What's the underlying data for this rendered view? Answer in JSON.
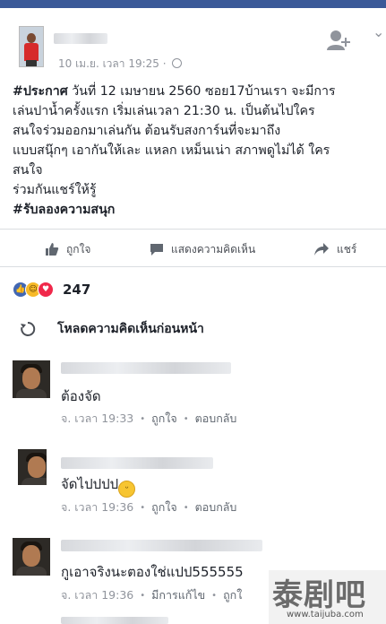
{
  "post": {
    "timestamp": "10 เม.ย. เวลา 19:25 · ",
    "hashtag_line1": "#ประกาศ",
    "body_line1": " วันที่ 12 เมษายน 2560 ซอย17บ้านเรา จะมีการ",
    "body_rest": "เล่นปาน้ำครั้งแรก เริ่มเล่นเวลา 21:30 น. เป็นต้นไปใคร\nสนใจร่วมออกมาเล่นกัน ต้อนรับสงการ์นที่จะมาถึง\nแบบสนุ๊กๆ เอากันให้เละ แหลก เหม็นเน่า สภาพดูไม่ได้ ใคร\nสนใจ\nร่วมกันแชร์ให้รู้",
    "hashtag_end": "#รับลองความสนุก"
  },
  "actions": {
    "like": "ถูกใจ",
    "comment": "แสดงความคิดเห็น",
    "share": "แชร์"
  },
  "reactions": {
    "count": "247"
  },
  "load_previous": "โหลดความคิดเห็นก่อนหน้า",
  "comments": [
    {
      "text": "ต้องจัด",
      "time": "จ. เวลา 19:33",
      "like": "ถูกใจ",
      "reply": "ตอบกลับ"
    },
    {
      "text": "จัดไปปปป",
      "time": "จ. เวลา 19:36",
      "like": "ถูกใจ",
      "reply": "ตอบกลับ"
    },
    {
      "text": "กูเอาจริงนะตองใช่แปป555555",
      "time": "จ. เวลา 19:36",
      "edited": "มีการแก้ไข",
      "like": "ถูกใ"
    }
  ],
  "watermark": {
    "chars": "泰剧吧",
    "url": "www.taijuba.com"
  },
  "colors": {
    "brand": "#3b5998",
    "meta_text": "#90949c",
    "text": "#1d2129"
  },
  "icons": [
    "globe-icon",
    "add-friend-icon",
    "chevron-down-icon",
    "thumbs-up-icon",
    "comment-bubble-icon",
    "share-arrow-icon",
    "reload-icon",
    "like-reaction-icon",
    "haha-reaction-icon",
    "love-reaction-icon",
    "grinning-emoji-icon"
  ]
}
